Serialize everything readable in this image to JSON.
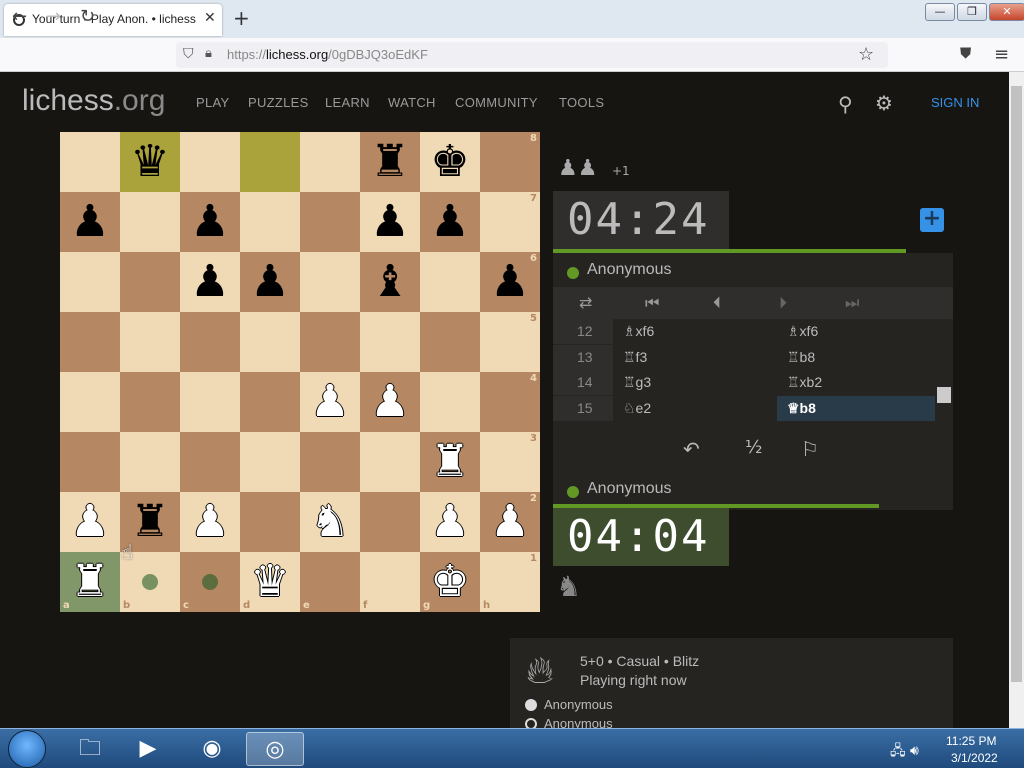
{
  "browser": {
    "tab_title": "Your turn - Play Anon. • lichess",
    "new_tab_icon": "+",
    "close_tab_icon": "✕",
    "url_prefix": "https://",
    "url_domain": "lichess.org",
    "url_path": "/0gDBJQ3oEdKF"
  },
  "site": {
    "logo_main": "lichess",
    "logo_tld": ".org",
    "menu": [
      "PLAY",
      "PUZZLES",
      "LEARN",
      "WATCH",
      "COMMUNITY",
      "TOOLS"
    ],
    "sign_in": "SIGN IN"
  },
  "board": {
    "files": [
      "a",
      "b",
      "c",
      "d",
      "e",
      "f",
      "g",
      "h"
    ],
    "ranks": [
      "8",
      "7",
      "6",
      "5",
      "4",
      "3",
      "2",
      "1"
    ],
    "rows": [
      [
        "",
        "bq",
        "",
        "",
        "",
        "br",
        "bk",
        ""
      ],
      [
        "bp",
        "",
        "bp",
        "",
        "",
        "bp",
        "bp",
        ""
      ],
      [
        "",
        "",
        "bp",
        "bp",
        "",
        "bb",
        "",
        "bp"
      ],
      [
        "",
        "",
        "",
        "",
        "",
        "",
        "",
        ""
      ],
      [
        "",
        "",
        "",
        "",
        "wp",
        "wp",
        "",
        ""
      ],
      [
        "",
        "",
        "",
        "",
        "",
        "",
        "wr",
        ""
      ],
      [
        "wp",
        "br",
        "wp",
        "",
        "wn",
        "",
        "wp",
        "wp"
      ],
      [
        "wr",
        "",
        "",
        "wq",
        "",
        "",
        "wk",
        ""
      ]
    ],
    "highlight_squares": [
      "b8",
      "d8"
    ],
    "selected_square": "a1",
    "move_dots": [
      "b1",
      "c1"
    ]
  },
  "game": {
    "captured": "♟♟",
    "captured_extra": "+1",
    "top_clock": "04:24",
    "bottom_clock": "04:04",
    "top_player": "Anonymous",
    "bottom_player": "Anonymous",
    "moves": [
      {
        "n": "12",
        "w": "♗xf6",
        "b": "♗xf6"
      },
      {
        "n": "13",
        "w": "♖f3",
        "b": "♖b8"
      },
      {
        "n": "14",
        "w": "♖g3",
        "b": "♖xb2"
      },
      {
        "n": "15",
        "w": "♘e2",
        "b": "♕b8"
      }
    ],
    "active_move": "15b",
    "draw_label": "½"
  },
  "info": {
    "title": "5+0 • Casual • Blitz",
    "subtitle": "Playing right now",
    "players": [
      "Anonymous",
      "Anonymous"
    ]
  },
  "taskbar": {
    "time": "11:25 PM",
    "date": "3/1/2022"
  },
  "colors": {
    "light_square": "#f0d9b5",
    "dark_square": "#b58863",
    "accent_green": "#629924",
    "link_blue": "#3692e7"
  }
}
